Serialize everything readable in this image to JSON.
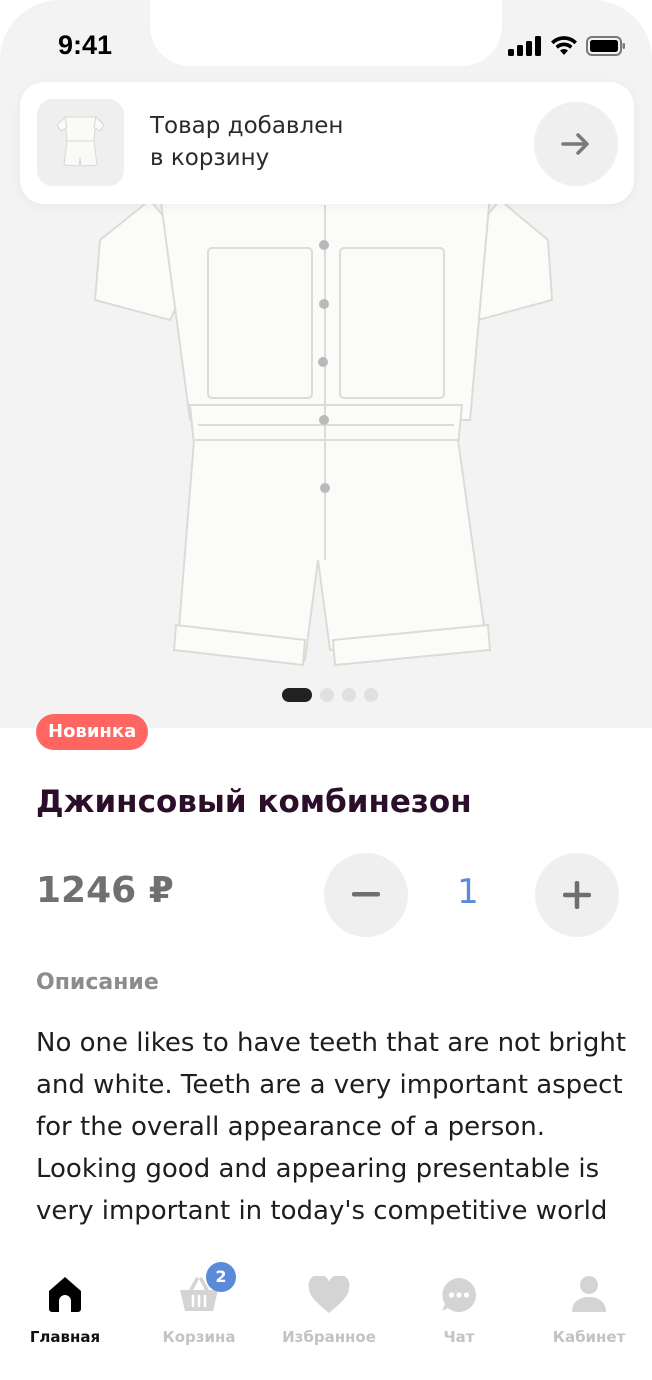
{
  "status_bar": {
    "time": "9:41"
  },
  "toast": {
    "line1": "Товар добавлен",
    "line2": "в корзину",
    "arrow_icon": "arrow-right-icon"
  },
  "gallery": {
    "total_slides": 4,
    "active_slide": 1
  },
  "product": {
    "badge": "Новинка",
    "title": "Джинсовый комбинезон",
    "price": "1246 ₽",
    "quantity": "1",
    "description_label": "Описание",
    "description": "No one likes to have teeth that are not bright and white. Teeth are a very important aspect for the overall appearance of a person. Looking good and appearing presentable is very important in today's competitive world"
  },
  "tabbar": {
    "items": [
      {
        "label": "Главная",
        "icon": "home-icon",
        "active": true
      },
      {
        "label": "Корзина",
        "icon": "basket-icon",
        "badge": "2"
      },
      {
        "label": "Избранное",
        "icon": "heart-icon"
      },
      {
        "label": "Чат",
        "icon": "chat-icon"
      },
      {
        "label": "Кабинет",
        "icon": "user-icon"
      }
    ]
  },
  "colors": {
    "badge": "#ff6661",
    "accent_blue": "#5b8ad9",
    "title": "#2a0e2a",
    "muted": "#8c8c8c",
    "button_bg": "#efefef"
  }
}
